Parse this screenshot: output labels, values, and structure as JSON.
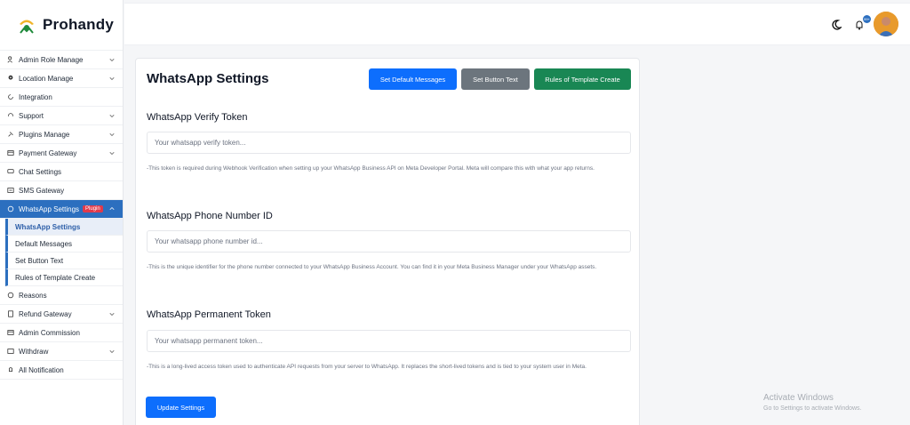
{
  "brand": {
    "name": "Prohandy"
  },
  "sidebar": {
    "items": [
      {
        "label": "Admin Role Manage",
        "icon": "users-icon",
        "chevron": true
      },
      {
        "label": "Location Manage",
        "icon": "location-icon",
        "chevron": true
      },
      {
        "label": "Integration",
        "icon": "refresh-icon",
        "chevron": false
      },
      {
        "label": "Support",
        "icon": "support-icon",
        "chevron": true
      },
      {
        "label": "Plugins Manage",
        "icon": "plug-icon",
        "chevron": true
      },
      {
        "label": "Payment Gateway",
        "icon": "card-icon",
        "chevron": true
      },
      {
        "label": "Chat Settings",
        "icon": "chat-icon",
        "chevron": false
      },
      {
        "label": "SMS Gateway",
        "icon": "message-icon",
        "chevron": false
      }
    ],
    "active": {
      "label": "WhatsApp Settings",
      "badge": "Plugin",
      "icon": "whatsapp-icon"
    },
    "subitems": [
      {
        "label": "WhatsApp Settings",
        "current": true
      },
      {
        "label": "Default Messages",
        "current": false
      },
      {
        "label": "Set Button Text",
        "current": false
      },
      {
        "label": "Rules of Template Create",
        "current": false
      }
    ],
    "items_after": [
      {
        "label": "Reasons",
        "icon": "info-icon",
        "chevron": false
      },
      {
        "label": "Refund Gateway",
        "icon": "receipt-icon",
        "chevron": true
      },
      {
        "label": "Admin Commission",
        "icon": "card-icon",
        "chevron": false
      },
      {
        "label": "Withdraw",
        "icon": "wallet-icon",
        "chevron": true
      },
      {
        "label": "All Notification",
        "icon": "bell-icon",
        "chevron": false
      }
    ]
  },
  "topbar": {
    "notification_count": "99+"
  },
  "page": {
    "title": "WhatsApp Settings",
    "buttons": {
      "default_messages": "Set Default Messages",
      "button_text": "Set Button Text",
      "template_rules": "Rules of Template Create"
    },
    "fields": [
      {
        "label": "WhatsApp Verify Token",
        "placeholder": "Your whatsapp verify token...",
        "value": "",
        "help": "-This token is required during Webhook Verification when setting up your WhatsApp Business API on Meta Developer Portal. Meta will compare this with what your app returns."
      },
      {
        "label": "WhatsApp Phone Number ID",
        "placeholder": "Your whatsapp phone number id...",
        "value": "",
        "help": "-This is the unique identifier for the phone number connected to your WhatsApp Business Account. You can find it in your Meta Business Manager under your WhatsApp assets."
      },
      {
        "label": "WhatsApp Permanent Token",
        "placeholder": "Your whatsapp permanent token...",
        "value": "",
        "help": "-This is a long-lived access token used to authenticate API requests from your server to WhatsApp. It replaces the short-lived tokens and is tied to your system user in Meta."
      }
    ],
    "submit_label": "Update Settings"
  },
  "watermark": {
    "title": "Activate Windows",
    "subtitle": "Go to Settings to activate Windows."
  },
  "colors": {
    "primary": "#0d6efd",
    "sidebar_active": "#2c6fbf",
    "secondary": "#6c757d",
    "success": "#198754",
    "badge": "#e23a4b"
  }
}
